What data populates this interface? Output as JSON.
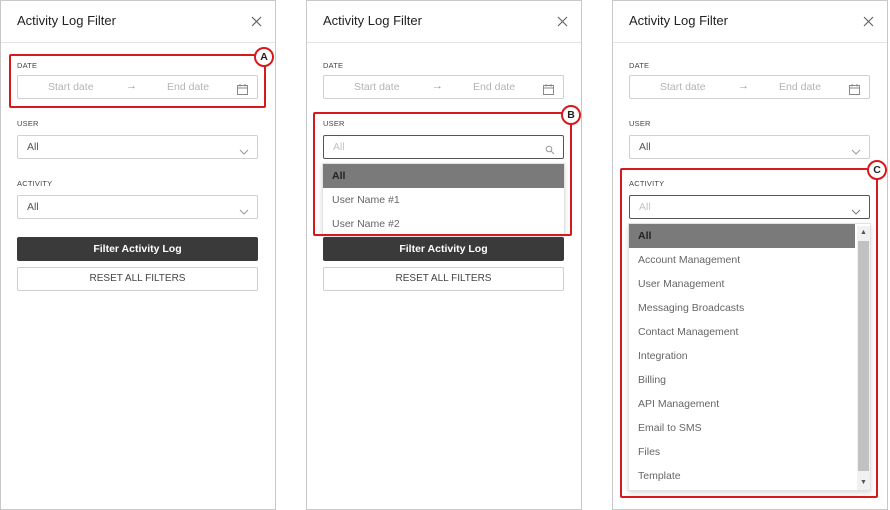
{
  "filter": {
    "title": "Activity Log Filter",
    "date_label": "DATE",
    "date_start_placeholder": "Start date",
    "date_arrow": "→",
    "date_end_placeholder": "End date",
    "user_label": "USER",
    "activity_label": "ACTIVITY",
    "user_value": "All",
    "activity_value": "All",
    "filter_button": "Filter Activity Log",
    "reset_button": "RESET ALL FILTERS"
  },
  "user_dropdown": {
    "search_placeholder": "All",
    "options": [
      "All",
      "User Name #1",
      "User Name #2"
    ],
    "selected": "All"
  },
  "activity_dropdown": {
    "search_placeholder": "All",
    "options": [
      "All",
      "Account Management",
      "User Management",
      "Messaging Broadcasts",
      "Contact Management",
      "Integration",
      "Billing",
      "API Management",
      "Email to SMS",
      "Files",
      "Template"
    ],
    "selected": "All"
  },
  "scroll": {
    "up_arrow": "▲",
    "down_arrow": "▼"
  },
  "markers": [
    "A",
    "B",
    "C"
  ],
  "colors": {
    "highlight": "#d7191c",
    "primary_button": "#3a3a3a",
    "selected_option": "#7a7a7a"
  },
  "icons": {
    "close": "close-icon",
    "calendar": "calendar-icon",
    "chevron": "chevron-down-icon",
    "search": "search-icon"
  }
}
